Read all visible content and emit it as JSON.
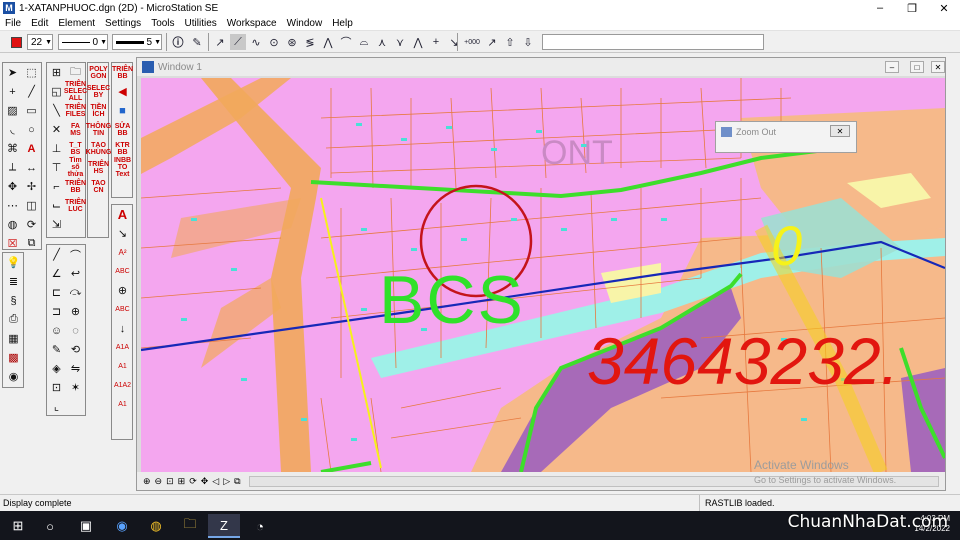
{
  "window": {
    "title": "1-XATANPHUOC.dgn (2D) - MicroStation SE",
    "minimize": "–",
    "restore": "❐",
    "close": "✕"
  },
  "menu": [
    "File",
    "Edit",
    "Element",
    "Settings",
    "Tools",
    "Utilities",
    "Workspace",
    "Window",
    "Help"
  ],
  "attributes": {
    "color_index": "22",
    "line_style": "0",
    "line_weight": "5",
    "active_color": "#e01010"
  },
  "palette_labels": {
    "p1": [
      "TRIÊN BB",
      "TRIÊN SELEC ALL",
      "SELEC BY",
      "TRIÊN FILES",
      "POLY GON",
      "FA MS",
      "TIỀN ÍCH",
      "SỬA BB",
      "T_T BS",
      "THÔNG TIN",
      "KTR BB",
      "Tìm số thửa",
      "TẠO KHUNG",
      "INBB TO Text",
      "TRIÊN BB",
      "TRIÊN HS",
      "TRIÊN LUC",
      "TAO CN"
    ]
  },
  "view": {
    "title": "Window 1",
    "zoom_dialog_title": "Zoom Out",
    "map_labels": {
      "zone_code": "ONT",
      "bcs": "BCS",
      "big_number": "34643232.",
      "yellow_zero": "0"
    }
  },
  "status": {
    "left": "Display complete",
    "right": "RASTLIB loaded."
  },
  "watermark": {
    "activate_title": "Activate Windows",
    "activate_sub": "Go to Settings to activate Windows.",
    "brand": "ChuanNhaDat.com"
  },
  "clock": {
    "time": "4:03 PM",
    "date": "14/2/2022"
  },
  "colors": {
    "parcel_pink": "#f4a6ef",
    "parcel_orange": "#f6b98a",
    "road_orange": "#f2a95b",
    "green_boundary": "#3dde2b",
    "purple_zone": "#a76ab8",
    "blue_line": "#1628b8",
    "red_circle": "#c4141b",
    "cyan_strip": "#9ff0e8",
    "red_number": "#e2160f",
    "yellow": "#f6f21a"
  }
}
